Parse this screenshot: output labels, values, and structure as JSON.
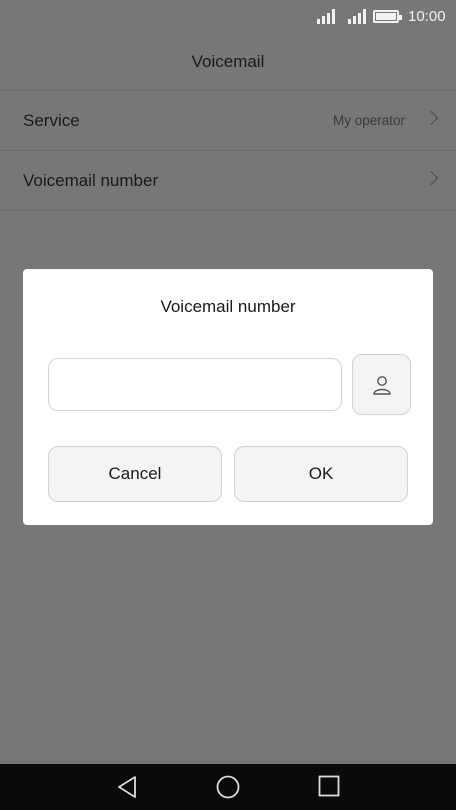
{
  "status_bar": {
    "time": "10:00",
    "icons": [
      "signal-icon",
      "signal-icon",
      "battery-icon"
    ]
  },
  "header": {
    "title": "Voicemail"
  },
  "settings": {
    "service": {
      "label": "Service",
      "value": "My operator"
    },
    "voicemail_number": {
      "label": "Voicemail number"
    }
  },
  "dialog": {
    "title": "Voicemail number",
    "input_value": "",
    "contact_icon": "person-icon",
    "cancel_label": "Cancel",
    "ok_label": "OK"
  },
  "nav_bar": {
    "icons": [
      "back-icon",
      "home-icon",
      "recents-icon"
    ]
  },
  "colors": {
    "overlay": "#777777",
    "dialog_bg": "#ffffff",
    "nav_bg": "#0a0a0a"
  }
}
